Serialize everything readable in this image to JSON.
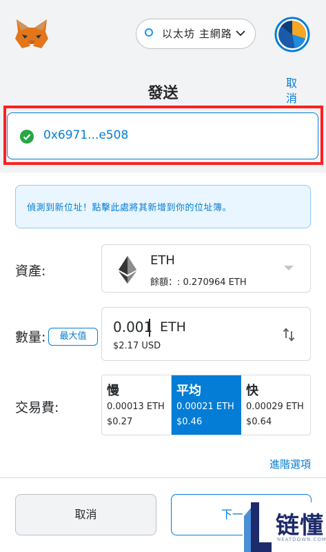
{
  "header": {
    "network_label": "以太坊 主網路",
    "title": "發送",
    "cancel_label": "取消"
  },
  "recipient": {
    "address": "0x6971...e508"
  },
  "alert": {
    "text": "偵測到新位址！點擊此處將其新增到你的位址簿。"
  },
  "asset": {
    "label": "資產:",
    "name": "ETH",
    "balance": "餘額：: 0.270964 ETH"
  },
  "amount": {
    "label": "數量:",
    "max_label": "最大值",
    "value": "0.001",
    "unit": "ETH",
    "fiat": "$2.17 USD"
  },
  "fee": {
    "label": "交易費:",
    "options": [
      {
        "name": "慢",
        "eth": "0.00013 ETH",
        "usd": "$0.27"
      },
      {
        "name": "平均",
        "eth": "0.00021 ETH",
        "usd": "$0.46"
      },
      {
        "name": "快",
        "eth": "0.00029 ETH",
        "usd": "$0.64"
      }
    ],
    "selected": "平均"
  },
  "advanced_label": "進階選項",
  "footer": {
    "cancel_label": "取消",
    "next_label": "下一"
  },
  "watermark": {
    "brand": "链懂",
    "sub": "NEATDOWN.COM"
  },
  "colors": {
    "accent": "#037dd6",
    "highlight": "#ff1f1f",
    "success": "#28a745"
  },
  "icons": [
    "metamask-fox-icon",
    "network-status-icon",
    "chevron-down-icon",
    "account-avatar-icon",
    "check-circle-icon",
    "eth-logo-icon",
    "dropdown-caret-icon",
    "swap-arrows-icon"
  ]
}
